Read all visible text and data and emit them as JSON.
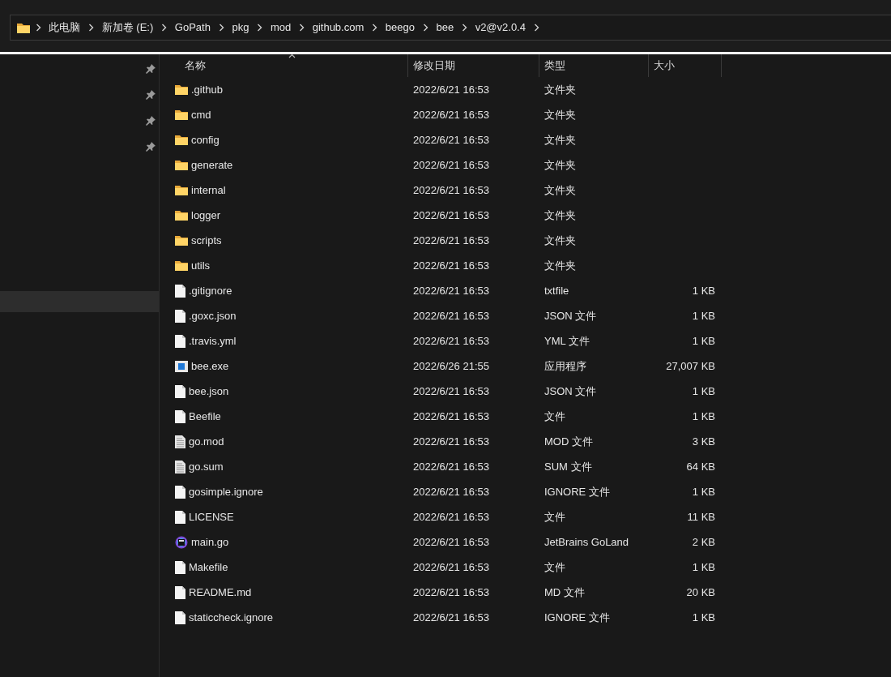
{
  "address_bar": {
    "segments": [
      "此电脑",
      "新加卷 (E:)",
      "GoPath",
      "pkg",
      "mod",
      "github.com",
      "beego",
      "bee",
      "v2@v2.0.4"
    ]
  },
  "sidebar": {
    "pinned_items": [
      {
        "pinned": true
      },
      {
        "pinned": true
      },
      {
        "pinned": true
      },
      {
        "pinned": true
      }
    ],
    "other_items": [
      {
        "selected": true
      }
    ]
  },
  "columns": [
    {
      "label": "名称",
      "sorted": true
    },
    {
      "label": "修改日期",
      "sorted": false
    },
    {
      "label": "类型",
      "sorted": false
    },
    {
      "label": "大小",
      "sorted": false
    }
  ],
  "rows": [
    {
      "kind": "folder",
      "name": ".github",
      "modified": "2022/6/21 16:53",
      "type": "文件夹"
    },
    {
      "kind": "folder",
      "name": "cmd",
      "modified": "2022/6/21 16:53",
      "type": "文件夹"
    },
    {
      "kind": "folder",
      "name": "config",
      "modified": "2022/6/21 16:53",
      "type": "文件夹"
    },
    {
      "kind": "folder",
      "name": "generate",
      "modified": "2022/6/21 16:53",
      "type": "文件夹"
    },
    {
      "kind": "folder",
      "name": "internal",
      "modified": "2022/6/21 16:53",
      "type": "文件夹"
    },
    {
      "kind": "folder",
      "name": "logger",
      "modified": "2022/6/21 16:53",
      "type": "文件夹"
    },
    {
      "kind": "folder",
      "name": "scripts",
      "modified": "2022/6/21 16:53",
      "type": "文件夹"
    },
    {
      "kind": "folder",
      "name": "utils",
      "modified": "2022/6/21 16:53",
      "type": "文件夹"
    },
    {
      "kind": "file",
      "name": ".gitignore",
      "modified": "2022/6/21 16:53",
      "type": "txtfile",
      "size": "1 KB"
    },
    {
      "kind": "file",
      "name": ".goxc.json",
      "modified": "2022/6/21 16:53",
      "type": "JSON 文件",
      "size": "1 KB"
    },
    {
      "kind": "file",
      "name": ".travis.yml",
      "modified": "2022/6/21 16:53",
      "type": "YML 文件",
      "size": "1 KB"
    },
    {
      "kind": "exe",
      "name": "bee.exe",
      "modified": "2022/6/26 21:55",
      "type": "应用程序",
      "size": "27,007 KB"
    },
    {
      "kind": "file",
      "name": "bee.json",
      "modified": "2022/6/21 16:53",
      "type": "JSON 文件",
      "size": "1 KB"
    },
    {
      "kind": "file",
      "name": "Beefile",
      "modified": "2022/6/21 16:53",
      "type": "文件",
      "size": "1 KB"
    },
    {
      "kind": "text",
      "name": "go.mod",
      "modified": "2022/6/21 16:53",
      "type": "MOD 文件",
      "size": "3 KB"
    },
    {
      "kind": "text",
      "name": "go.sum",
      "modified": "2022/6/21 16:53",
      "type": "SUM 文件",
      "size": "64 KB"
    },
    {
      "kind": "file",
      "name": "gosimple.ignore",
      "modified": "2022/6/21 16:53",
      "type": "IGNORE 文件",
      "size": "1 KB"
    },
    {
      "kind": "file",
      "name": "LICENSE",
      "modified": "2022/6/21 16:53",
      "type": "文件",
      "size": "11 KB"
    },
    {
      "kind": "goland",
      "name": "main.go",
      "modified": "2022/6/21 16:53",
      "type": "JetBrains GoLand",
      "size": "2 KB"
    },
    {
      "kind": "file",
      "name": "Makefile",
      "modified": "2022/6/21 16:53",
      "type": "文件",
      "size": "1 KB"
    },
    {
      "kind": "file",
      "name": "README.md",
      "modified": "2022/6/21 16:53",
      "type": "MD 文件",
      "size": "20 KB"
    },
    {
      "kind": "file",
      "name": "staticcheck.ignore",
      "modified": "2022/6/21 16:53",
      "type": "IGNORE 文件",
      "size": "1 KB"
    }
  ]
}
